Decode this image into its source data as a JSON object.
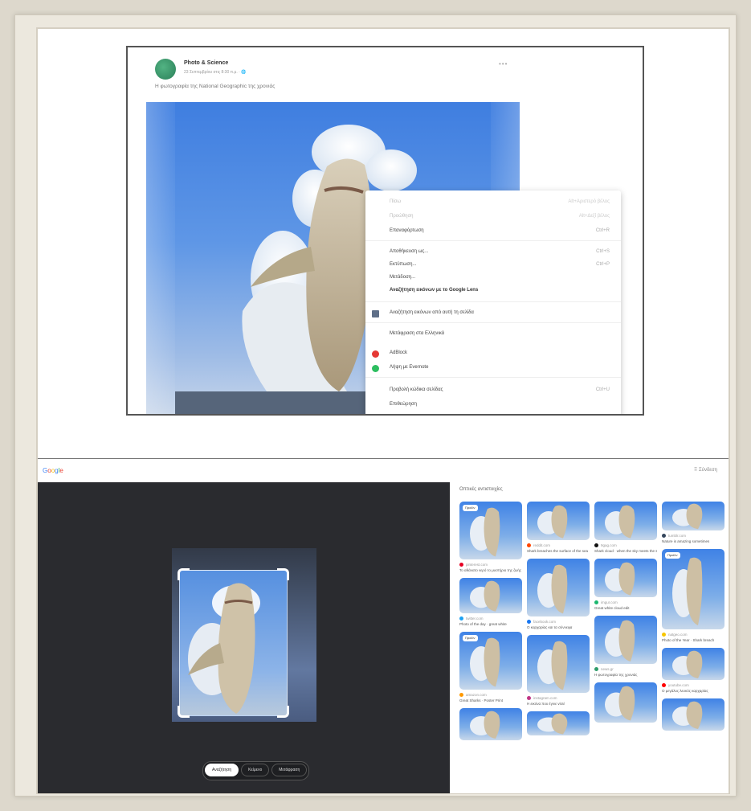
{
  "colors": {
    "frame": "#ece8de",
    "sky": "#4a85e2",
    "lens_dark": "#2a2b2f",
    "accent_green": "#2e9c6a"
  },
  "post": {
    "page_name": "Photo & Science",
    "meta": "23 Σεπτεμβρίου στις 8:30 π.μ. · 🌐",
    "more_icon": "more-horizontal-icon",
    "caption": "Η φωτογραφία της National Geographic της χρονιάς"
  },
  "context_menu": {
    "items": [
      {
        "label": "Πίσω",
        "shortcut": "Alt+Αριστερό βέλος",
        "faded": true
      },
      {
        "label": "Προώθηση",
        "shortcut": "Alt+Δεξί βέλος",
        "faded": true
      },
      {
        "label": "Επαναφόρτωση",
        "shortcut": "Ctrl+R",
        "faded": false
      },
      {
        "label": "Αποθήκευση ως...",
        "shortcut": "Ctrl+S",
        "faded": false
      },
      {
        "label": "Εκτύπωση...",
        "shortcut": "Ctrl+P",
        "faded": false
      },
      {
        "label": "Μετάδοση...",
        "shortcut": "",
        "faded": false
      },
      {
        "label": "Αναζήτηση εικόνων με το Google Lens",
        "shortcut": "",
        "faded": false,
        "bold": true
      },
      {
        "label": "Αναζήτηση εικόνων από αυτή τη σελίδα",
        "shortcut": "",
        "faded": false,
        "icon": "grid"
      },
      {
        "label": "Μετάφραση στα Ελληνικά",
        "shortcut": "",
        "faded": false
      },
      {
        "label": "AdBlock",
        "shortcut": "",
        "faded": false,
        "icon": "adblock"
      },
      {
        "label": "Λήψη με Evernote",
        "shortcut": "",
        "faded": false,
        "icon": "evernote"
      },
      {
        "label": "Προβολή κώδικα σελίδας",
        "shortcut": "Ctrl+U",
        "faded": false
      },
      {
        "label": "Επιθεώρηση",
        "shortcut": "",
        "faded": false
      }
    ]
  },
  "lens": {
    "google_label": "Google",
    "topbar_right": "⠿ Σύνδεση",
    "results_title": "Οπτικές αντιστοιχίες",
    "tabs": [
      {
        "label": "Αναζήτηση",
        "active": true
      },
      {
        "label": "Κείμενο",
        "active": false
      },
      {
        "label": "Μετάφραση",
        "active": false
      }
    ],
    "results": [
      [
        {
          "source": "pinterest.com",
          "title": "Το αθάνατο νερό το μυστήριο της ζωής",
          "dot": "#e60023",
          "h": 72,
          "badge": "Προϊόν"
        },
        {
          "source": "twitter.com",
          "title": "Photo of the day · great white",
          "dot": "#1da1f2",
          "h": 44
        },
        {
          "source": "amazon.com",
          "title": "Great Sharks · Poster Print",
          "dot": "#ff9900",
          "h": 72,
          "badge": "Προϊόν"
        },
        {
          "source": "",
          "title": "",
          "dot": "#999",
          "h": 40
        }
      ],
      [
        {
          "source": "reddit.com",
          "title": "Shark breaches the surface of the sea",
          "dot": "#ff4500",
          "h": 48
        },
        {
          "source": "facebook.com",
          "title": "Ο καρχαρίας και τα σύννεφα",
          "dot": "#1877f2",
          "h": 72
        },
        {
          "source": "instagram.com",
          "title": "Η εικόνα που έγινε viral",
          "dot": "#c13584",
          "h": 72
        },
        {
          "source": "",
          "title": "",
          "dot": "#999",
          "h": 30
        }
      ],
      [
        {
          "source": "9gag.com",
          "title": "Shark cloud · when the sky meets the sea",
          "dot": "#111111",
          "h": 48
        },
        {
          "source": "imgur.com",
          "title": "Great white cloud edit",
          "dot": "#1bb76e",
          "h": 48
        },
        {
          "source": "news.gr",
          "title": "Η φωτογραφία της χρονιάς",
          "dot": "#2e9c6a",
          "h": 60
        },
        {
          "source": "",
          "title": "",
          "dot": "#999",
          "h": 50
        }
      ],
      [
        {
          "source": "tumblr.com",
          "title": "Nature is amazing sometimes",
          "dot": "#35465c",
          "h": 36
        },
        {
          "source": "natgeo.com",
          "title": "Photo of the Year · Shark breach",
          "dot": "#f7c600",
          "h": 100,
          "badge": "Προϊόν"
        },
        {
          "source": "youtube.com",
          "title": "Ο μεγάλος λευκός καρχαρίας",
          "dot": "#ff0000",
          "h": 40
        },
        {
          "source": "",
          "title": "",
          "dot": "#999",
          "h": 40
        }
      ]
    ]
  }
}
